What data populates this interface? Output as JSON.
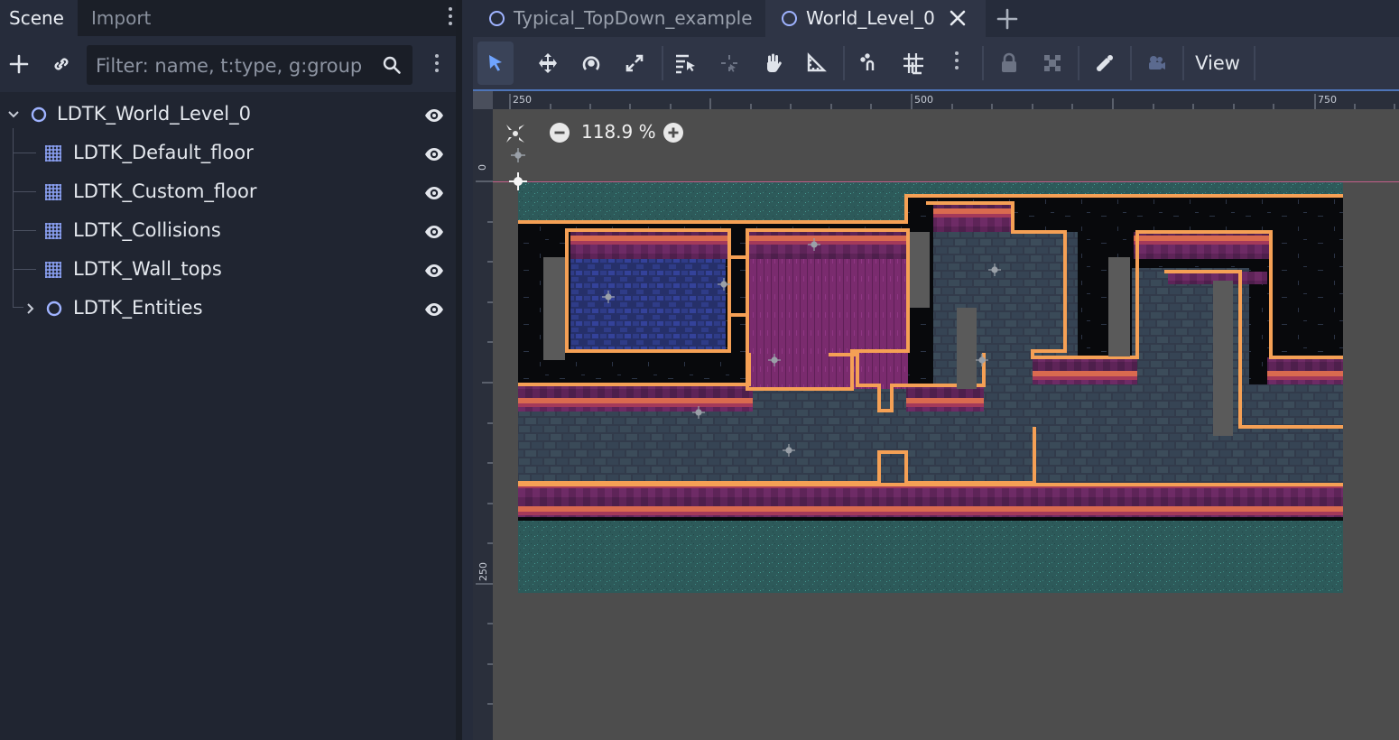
{
  "dock": {
    "tabs": [
      {
        "label": "Scene"
      },
      {
        "label": "Import"
      }
    ],
    "filter": {
      "placeholder": "Filter: name, t:type, g:group",
      "value": ""
    },
    "tree": [
      {
        "label": "LDTK_World_Level_0",
        "icon": "node2d-icon",
        "visible": true
      },
      {
        "label": "LDTK_Default_floor",
        "icon": "tilemap-icon",
        "visible": true
      },
      {
        "label": "LDTK_Custom_floor",
        "icon": "tilemap-icon",
        "visible": true
      },
      {
        "label": "LDTK_Collisions",
        "icon": "tilemap-icon",
        "visible": true
      },
      {
        "label": "LDTK_Wall_tops",
        "icon": "tilemap-icon",
        "visible": true
      },
      {
        "label": "LDTK_Entities",
        "icon": "node2d-icon",
        "visible": true,
        "collapsed": true
      }
    ]
  },
  "editor": {
    "scene_tabs": [
      {
        "label": "Typical_TopDown_example",
        "active": false
      },
      {
        "label": "World_Level_0",
        "active": true
      }
    ],
    "toolbar": {
      "view_label": "View"
    },
    "rulers": {
      "top": [
        "250",
        "500",
        "750"
      ],
      "left": [
        "0",
        "250"
      ]
    },
    "zoom": {
      "label": "118.9 %"
    }
  },
  "colors": {
    "accent": "#4e75b9",
    "node_icon": "#9fb3ff",
    "tile_teal": "#2e5b5b",
    "wall_orange": "#f2924a",
    "wall_purple": "#6e2b6b",
    "brick_gray": "#3b4656"
  }
}
